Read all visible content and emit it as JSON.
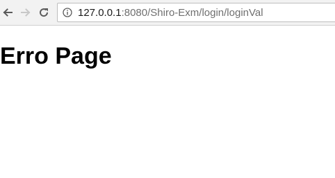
{
  "browser": {
    "url_host": "127.0.0.1",
    "url_rest": ":8080/Shiro-Exm/login/loginVal",
    "back_icon": "back-arrow-icon",
    "forward_icon": "forward-arrow-icon",
    "reload_icon": "reload-icon",
    "info_icon": "info-icon",
    "forward_enabled": false
  },
  "page": {
    "heading": "Erro Page"
  },
  "colors": {
    "toolbar_bg": "#f2f2f2",
    "url_host": "#1a1a1a",
    "url_rest": "#6f6f6f",
    "heading": "#000000"
  }
}
